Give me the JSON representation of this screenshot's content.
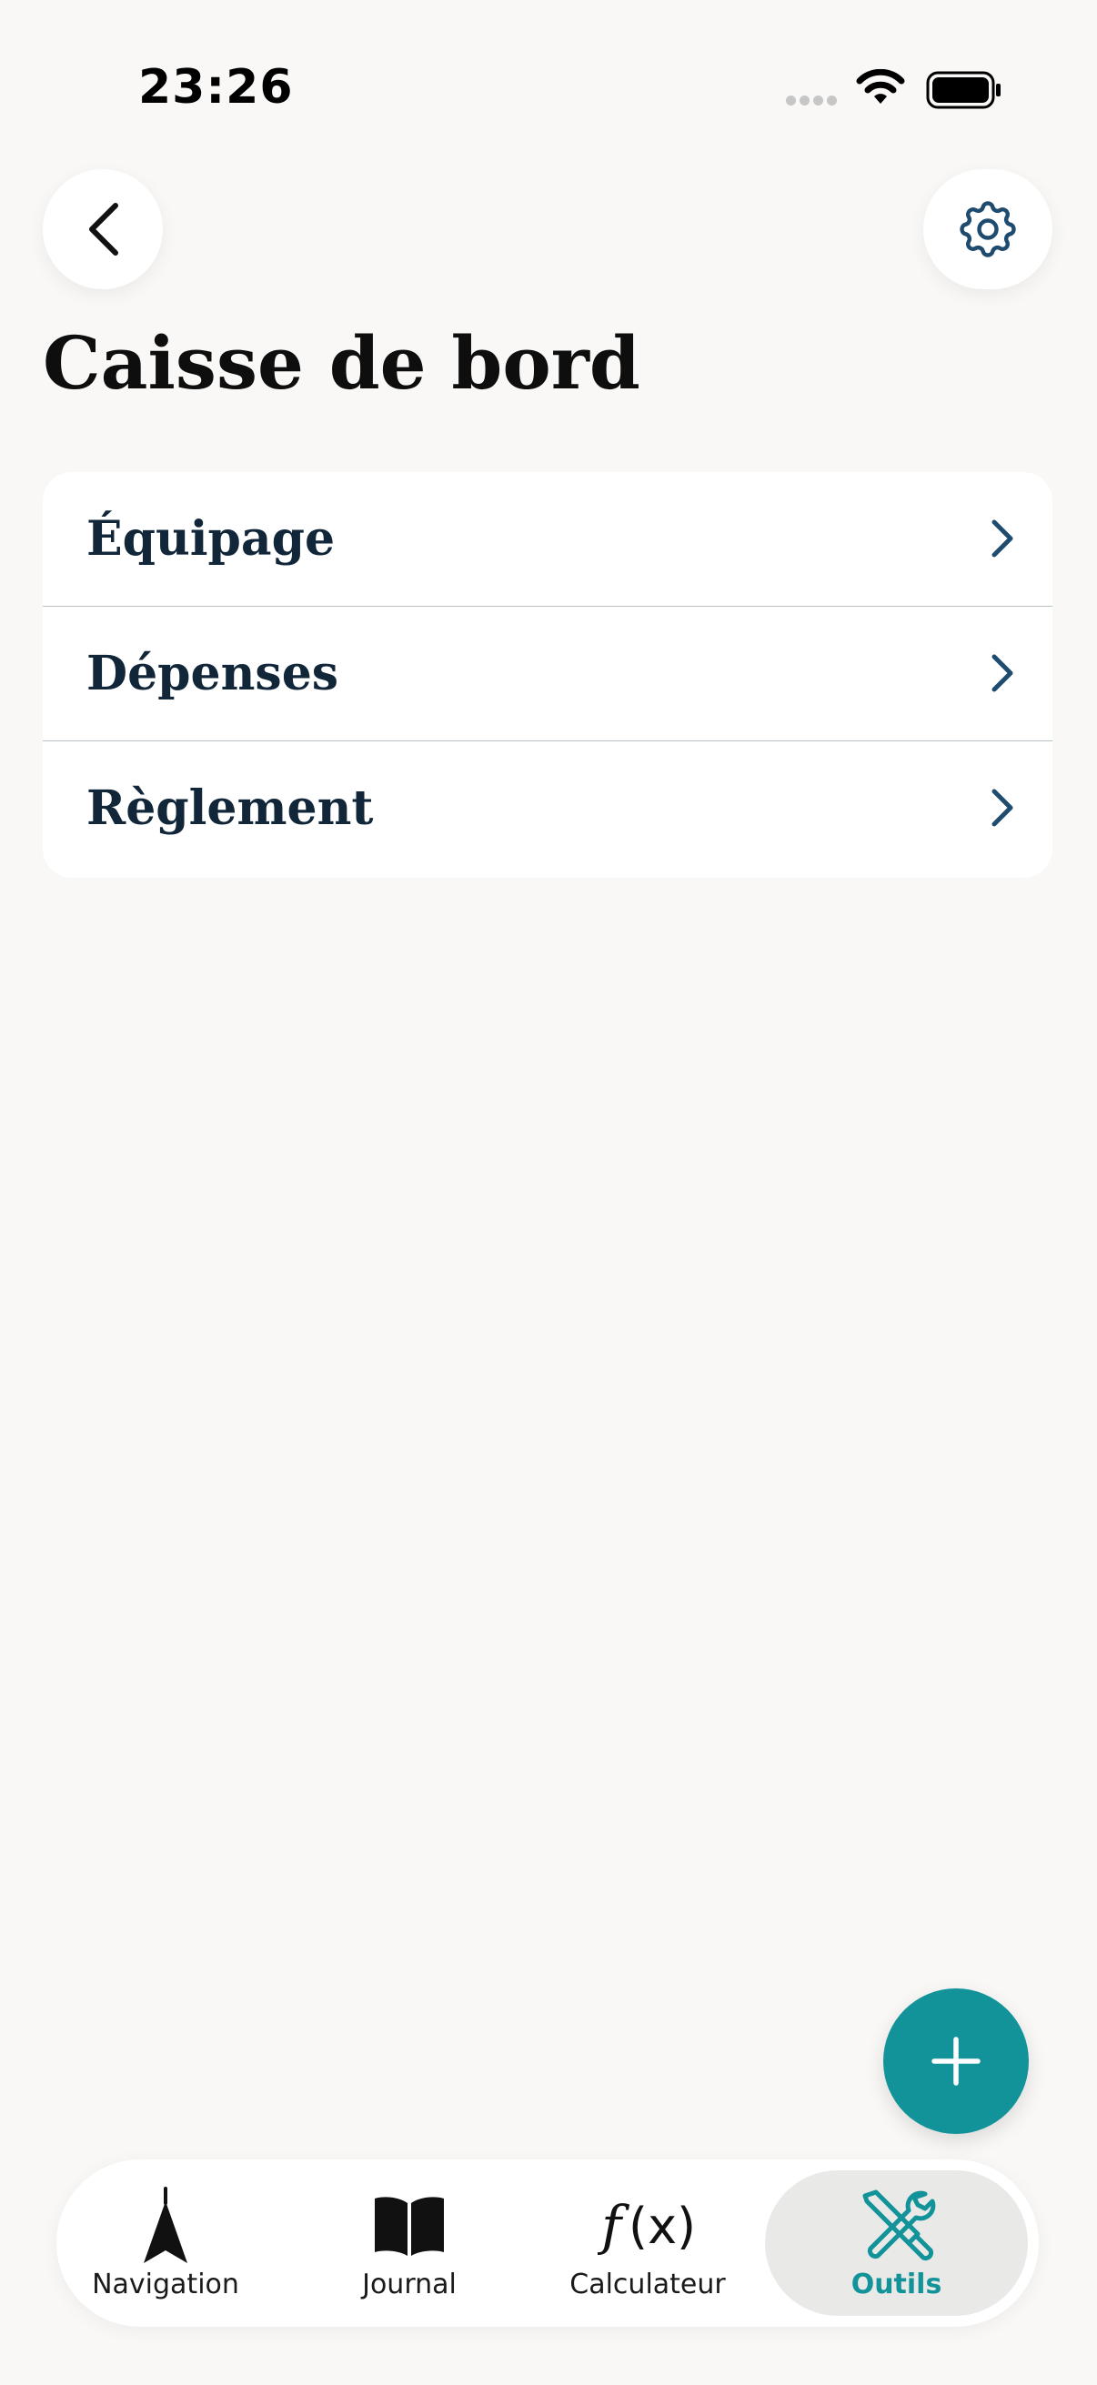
{
  "status_bar": {
    "time": "23:26"
  },
  "header": {
    "title": "Caisse de bord"
  },
  "menu": {
    "items": [
      {
        "label": "Équipage"
      },
      {
        "label": "Dépenses"
      },
      {
        "label": "Règlement"
      }
    ]
  },
  "tabs": [
    {
      "label": "Navigation",
      "icon": "navigation-arrow-icon"
    },
    {
      "label": "Journal",
      "icon": "book-icon"
    },
    {
      "label": "Calculateur",
      "icon": "function-icon"
    },
    {
      "label": "Outils",
      "icon": "tools-icon",
      "active": true
    }
  ],
  "colors": {
    "accent": "#12939a",
    "background": "#f9f8f6",
    "row_text": "#12263a",
    "chevron": "#1f4b6e"
  }
}
